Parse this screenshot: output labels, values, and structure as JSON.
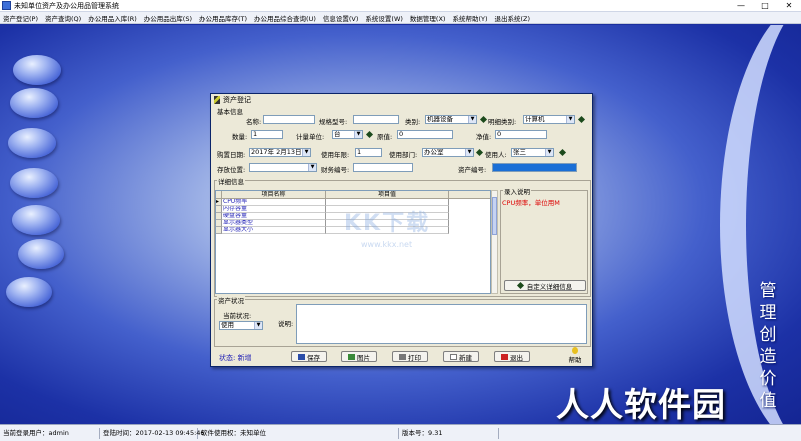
{
  "window": {
    "title": "未知单位资产及办公用品管理系统",
    "controls": [
      "—",
      "□",
      "✕"
    ]
  },
  "menu": [
    "资产登记(P)",
    "资产查询(Q)",
    "办公用品入库(R)",
    "办公用品出库(S)",
    "办公用品库存(T)",
    "办公用品综合查询(U)",
    "信息设置(V)",
    "系统设置(W)",
    "数据管理(X)",
    "系统帮助(Y)",
    "退出系统(Z)"
  ],
  "dialog": {
    "title": "资产登记",
    "basic_group": "基本信息",
    "fields": {
      "name_label": "名称:",
      "name_value": "",
      "model_label": "规格型号:",
      "model_value": "",
      "category_label": "类别:",
      "category_value": "机器设备",
      "subcategory_label": "明细类别:",
      "subcategory_value": "计算机",
      "quantity_label": "数量:",
      "quantity_value": "1",
      "unit_label": "计量单位:",
      "unit_value": "台",
      "original_label": "原值:",
      "original_value": "0",
      "net_label": "净值:",
      "net_value": "0",
      "purchase_date_label": "购置日期:",
      "purchase_date_value": "2017年 2月13日",
      "years_label": "使用年限:",
      "years_value": "1",
      "dept_label": "使用部门:",
      "dept_value": "办公室",
      "user_label": "使用人:",
      "user_value": "张三",
      "location_label": "存放位置:",
      "location_value": "",
      "finance_label": "财务编号:",
      "finance_value": "",
      "asset_no_label": "资产编号:"
    },
    "detail_group": "详细信息",
    "grid": {
      "headers": [
        "项目名称",
        "项目值"
      ],
      "rows": [
        "CPU频率",
        "内存容量",
        "硬盘容量",
        "显示器类型",
        "显示器大小"
      ]
    },
    "input_hint": {
      "label": "录入说明",
      "text": "CPU频率，单位用M"
    },
    "custom_button": "自定义详细信息",
    "status_group": "资产状况",
    "current_status_label": "当前状况:",
    "current_status_value": "使用",
    "remark_label": "说明:",
    "state_label": "状态: 新增",
    "buttons": {
      "save": "保存",
      "image": "图片",
      "print": "打印",
      "new": "新建",
      "exit": "退出",
      "help": "帮助"
    }
  },
  "slogan": [
    "管",
    "理",
    "创",
    "造",
    "价",
    "值"
  ],
  "watermark_url": "www.kkx.net",
  "watermark_bottom": "人人软件园",
  "statusbar": {
    "login_user": "当前登录用户：admin",
    "login_time": "登陆时间：2017-02-13 09:45:46",
    "licensee": "软件使用权：未知单位",
    "version": "版本号：9.31"
  }
}
